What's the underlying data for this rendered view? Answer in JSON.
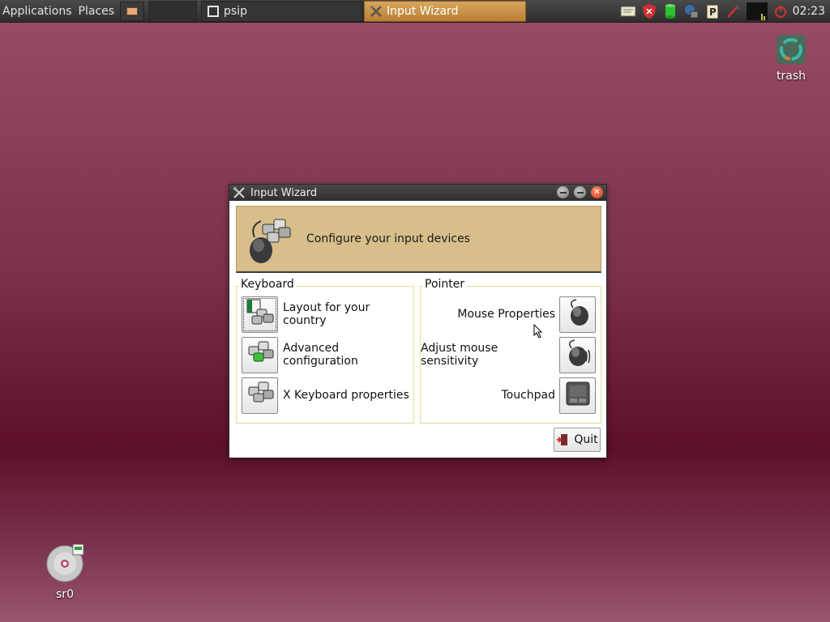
{
  "taskbar": {
    "menus": [
      "Applications",
      "Places"
    ],
    "tasks": [
      {
        "label": "psip",
        "icon": "window-icon",
        "active": false
      },
      {
        "label": "Input Wizard",
        "icon": "tools-icon",
        "active": true
      }
    ],
    "tray_icons": [
      "notes-icon",
      "shield-icon",
      "database-icon",
      "network-icon",
      "clipboard-icon",
      "pen-icon",
      "cpu-monitor-icon",
      "power-icon"
    ],
    "clock": "02:23"
  },
  "desktop": {
    "trash_label": "trash",
    "drive_label": "sr0"
  },
  "window": {
    "title": "Input Wizard",
    "banner_text": "Configure your input devices",
    "keyboard": {
      "label": "Keyboard",
      "items": [
        {
          "label": "Layout for your country",
          "icon": "keyboard-flag-icon"
        },
        {
          "label": "Advanced configuration",
          "icon": "keyboard-advanced-icon"
        },
        {
          "label": "X Keyboard properties",
          "icon": "keyboard-icon"
        }
      ]
    },
    "pointer": {
      "label": "Pointer",
      "items": [
        {
          "label": "Mouse Properties",
          "icon": "mouse-icon"
        },
        {
          "label": "Adjust mouse sensitivity",
          "icon": "mouse-sensitivity-icon"
        },
        {
          "label": "Touchpad",
          "icon": "touchpad-icon"
        }
      ]
    },
    "quit_label": "Quit"
  },
  "colors": {
    "active_task": "#c8924a",
    "banner": "#d8be8a",
    "close_button": "#e04a28",
    "group_border": "#e6dc9a"
  }
}
